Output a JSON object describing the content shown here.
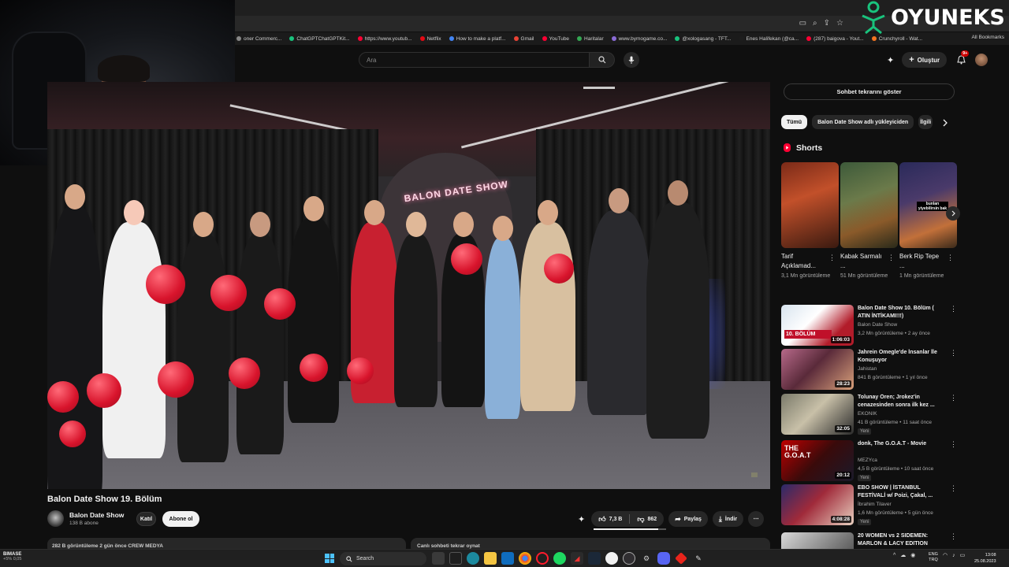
{
  "bookmarks": [
    "oner Commerc...",
    "ChatGPTChatGPTKit...",
    "https://www.youtub...",
    "Netflix",
    "How to make a platf...",
    "Gmail",
    "YouTube",
    "Haritalar",
    "www.bymogame.co...",
    "@xologasang - TFT...",
    "Enes Halifekan (@ca...",
    "(287) baigova - Yout...",
    "Crunchyroll - Wat..."
  ],
  "bookmarks_all": "All Bookmarks",
  "logo": {
    "text": "OYUNEKS"
  },
  "yt_header": {
    "search_placeholder": "Ara",
    "create_label": "Oluştur",
    "notifications_count": "9+"
  },
  "video": {
    "title": "Balon Date Show 19. Bölüm",
    "neon_sign": "BALON DATE SHOW",
    "channel": {
      "name": "Balon Date Show",
      "subscribers": "138 B abone"
    },
    "join_label": "Katıl",
    "subscribe_label": "Abone ol",
    "likes": "7,3 B",
    "dislikes": "862",
    "like_ratio": 0.89,
    "share_label": "Paylaş",
    "download_label": "İndir",
    "description_preview": "282 B görüntüleme  2 gün önce  CREW MEDYA",
    "comments_preview": "Canlı sohbeti tekrar oynat"
  },
  "sidebar": {
    "chat_replay_label": "Sohbet tekrarını göster",
    "chips": [
      {
        "label": "Tümü",
        "active": true
      },
      {
        "label": "Balon Date Show adlı yükleyiciden",
        "active": false
      },
      {
        "label": "İlgili",
        "active": false
      }
    ],
    "shorts_title": "Shorts",
    "shorts": [
      {
        "title": "Tarif Açıklamad...",
        "views": "3,1 Mn görüntüleme"
      },
      {
        "title": "Kabak Sarmalı ...",
        "views": "51 Mn görüntüleme",
        "overlay": ""
      },
      {
        "title": "Berk Rip Tepe ...",
        "views": "1 Mn görüntüleme",
        "overlay": "bunları yiyebilirsin bak"
      }
    ],
    "videos": [
      {
        "title": "Balon Date Show 10. Bölüm ( ATIN İNTİKAMI!!!)",
        "channel": "Balon Date Show",
        "meta": "3,2 Mn görüntüleme • 2 ay önce",
        "duration": "1:06:03",
        "thumb_label": "10. BÖLÜM",
        "badge": ""
      },
      {
        "title": "Jahrein Omegle'de İnsanlar İle Konuşuyor",
        "channel": "Jahistan",
        "meta": "841 B görüntüleme • 1 yıl önce",
        "duration": "28:23",
        "thumb_label": "",
        "badge": ""
      },
      {
        "title": "Tolunay Ören; Jrokez'in cenazesinden sonra ilk kez ...",
        "channel": "EKONIK",
        "meta": "41 B görüntüleme • 11 saat önce",
        "duration": "32:05",
        "thumb_label": "",
        "badge": "Yeni"
      },
      {
        "title": "donk, The G.O.A.T - Movie",
        "channel": "MEZYca",
        "meta": "4,5 B görüntüleme • 10 saat önce",
        "duration": "20:12",
        "thumb_label": "THE G.O.A.T",
        "badge": "Yeni"
      },
      {
        "title": "EBO SHOW | İSTANBUL FESTİVALİ w/ Poizi, Çakal, ...",
        "channel": "İbrahim Tilaver",
        "meta": "1,6 Mn görüntüleme • 5 gün önce",
        "duration": "4:08:28",
        "thumb_label": "",
        "badge": "Yeni"
      },
      {
        "title": "20 WOMEN vs 2 SIDEMEN: MARLON & LACY EDITION",
        "channel": "",
        "meta": "",
        "duration": "",
        "thumb_label": "",
        "badge": ""
      }
    ]
  },
  "taskbar": {
    "weather_title": "BIMASE",
    "weather_sub": "+5% 0,05",
    "search_label": "Search",
    "lang_line1": "ENG",
    "lang_line2": "TRQ",
    "time": "13:08",
    "date": "25.08.2023"
  },
  "colors": {
    "background": "#0f0f0f",
    "accent_red": "#ff0033",
    "balloon_red": "#d8142c",
    "text": "#f1f1f1",
    "muted": "#aaaaaa"
  }
}
